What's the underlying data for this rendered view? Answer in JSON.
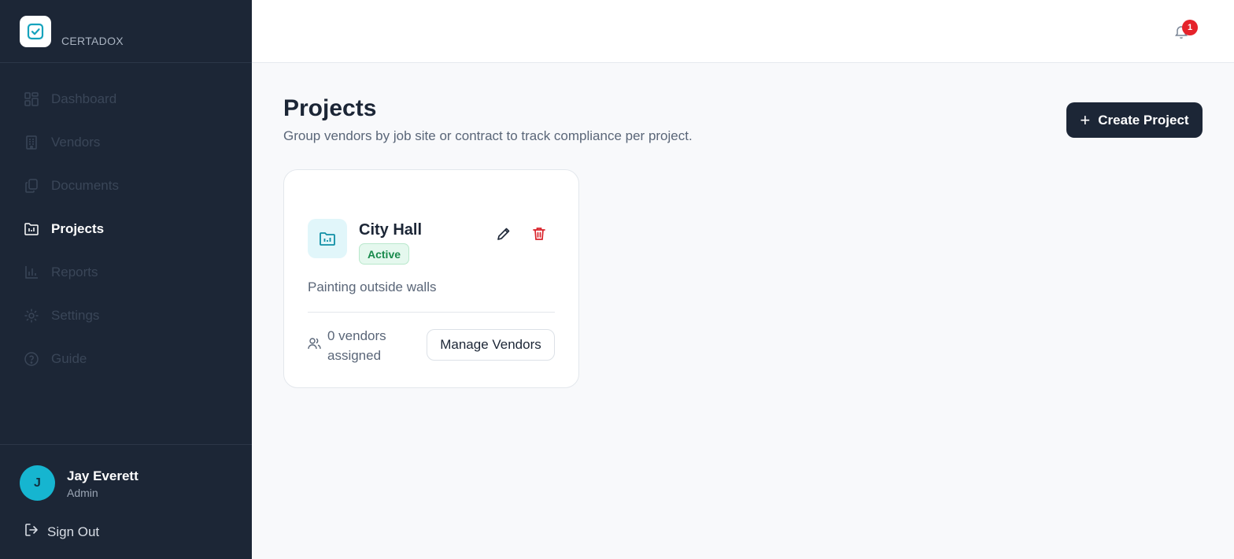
{
  "brand": {
    "name": "CERTADOX",
    "logo_icon": "check-square-icon"
  },
  "sidebar": {
    "items": [
      {
        "label": "Dashboard",
        "icon": "grid-icon",
        "active": false
      },
      {
        "label": "Vendors",
        "icon": "building-icon",
        "active": false
      },
      {
        "label": "Documents",
        "icon": "documents-icon",
        "active": false
      },
      {
        "label": "Projects",
        "icon": "folder-chart-icon",
        "active": true
      },
      {
        "label": "Reports",
        "icon": "bar-chart-icon",
        "active": false
      },
      {
        "label": "Settings",
        "icon": "gear-icon",
        "active": false
      },
      {
        "label": "Guide",
        "icon": "help-circle-icon",
        "active": false
      }
    ]
  },
  "user": {
    "initial": "J",
    "name": "Jay Everett",
    "role": "Admin"
  },
  "signout": {
    "label": "Sign Out",
    "icon": "logout-icon"
  },
  "topbar": {
    "notification_count": "1",
    "bell_icon": "bell-icon"
  },
  "page": {
    "title": "Projects",
    "subtitle": "Group vendors by job site or contract to track compliance per project.",
    "create_button": "Create Project"
  },
  "projects": [
    {
      "name": "City Hall",
      "status": "Active",
      "description": "Painting outside walls",
      "vendors_text": "0 vendors assigned",
      "manage_label": "Manage Vendors"
    }
  ],
  "colors": {
    "sidebar_bg": "#1c2636",
    "accent": "#16b5d0",
    "danger": "#e5232b",
    "success": "#198a4c"
  }
}
